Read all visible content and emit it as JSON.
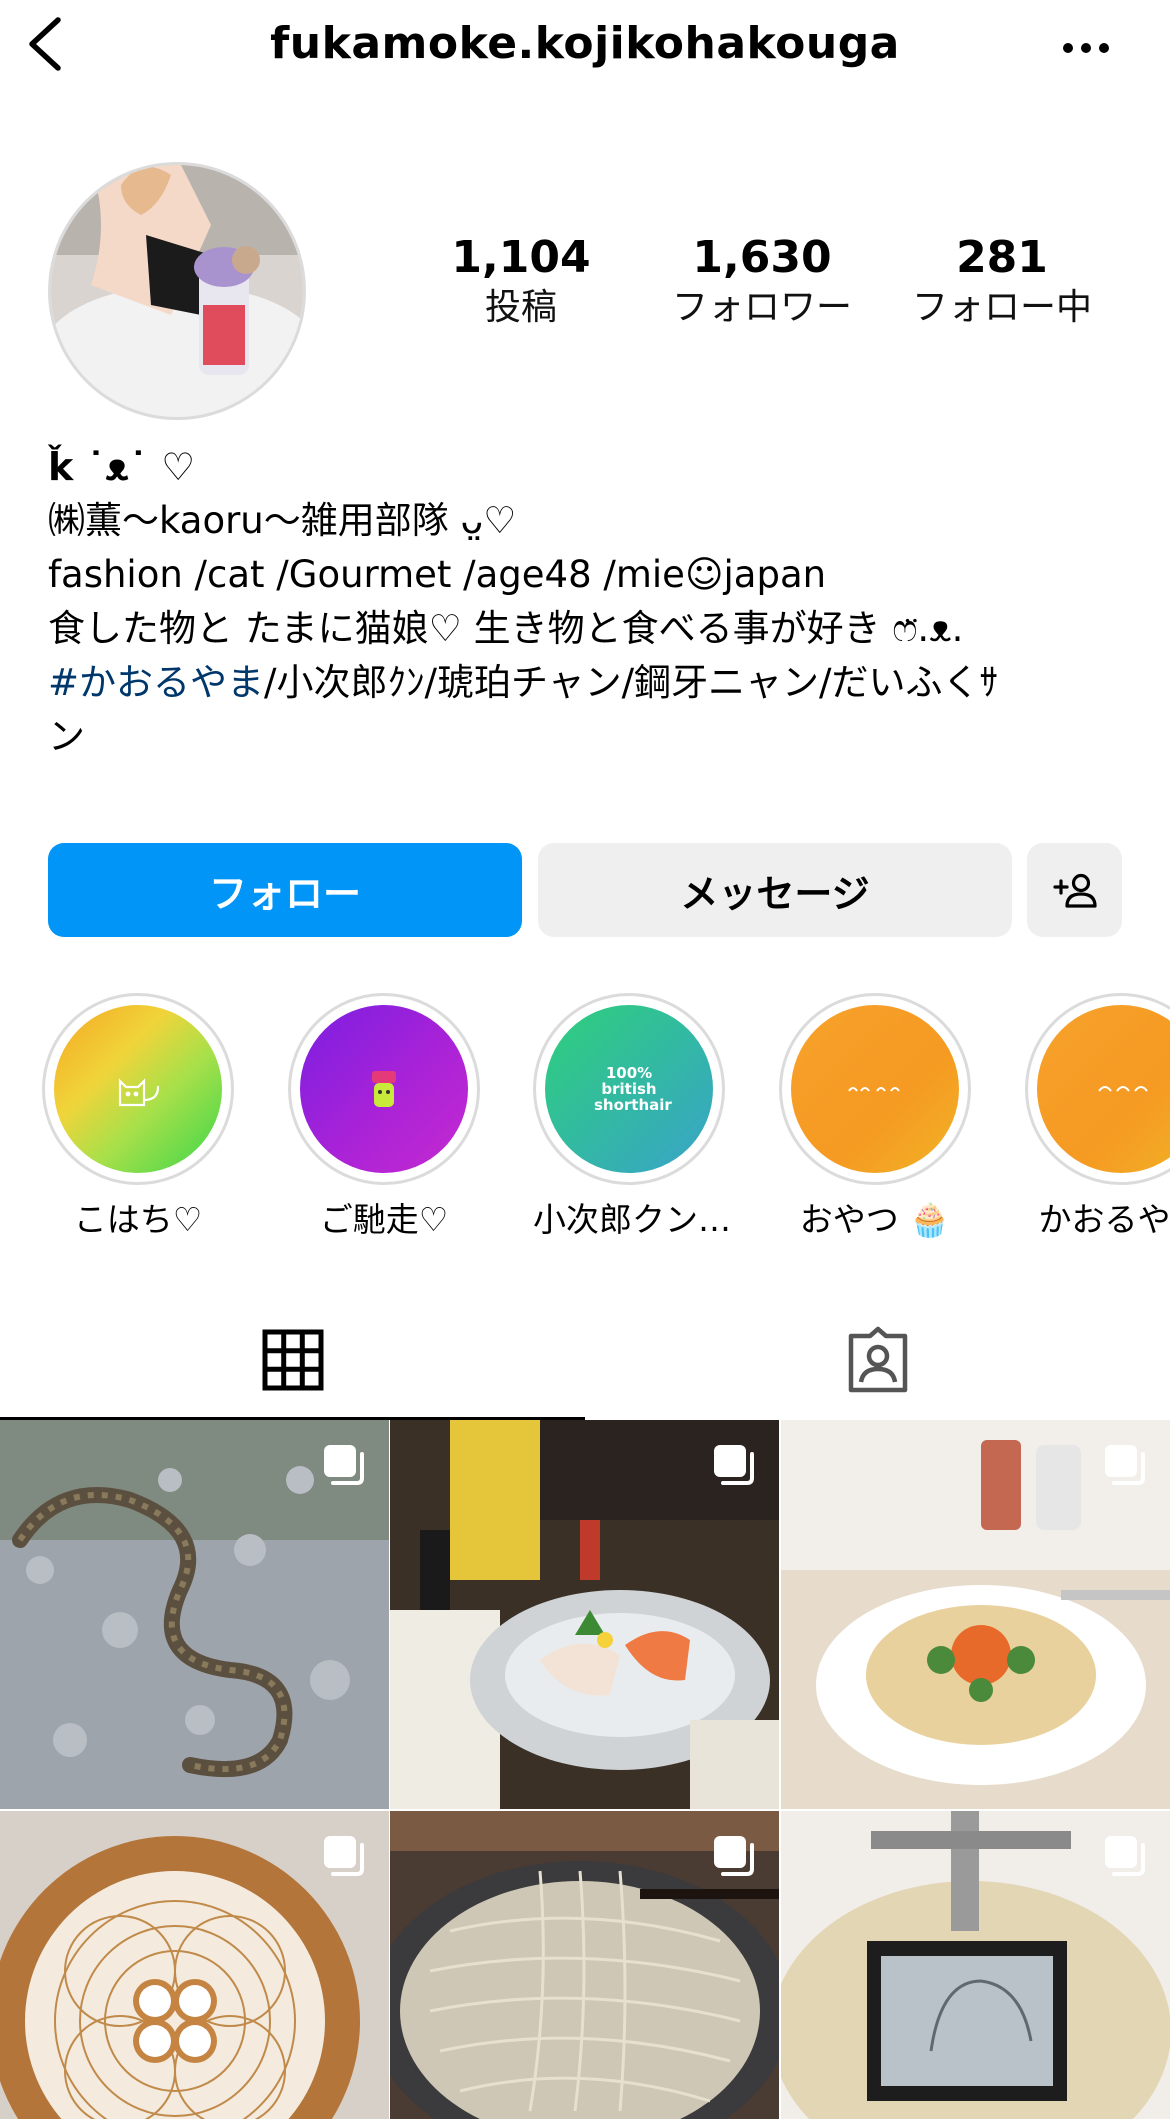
{
  "header": {
    "username": "fukamoke.kojikohakouga"
  },
  "stats": [
    {
      "value": "1,104",
      "label": "投稿"
    },
    {
      "value": "1,630",
      "label": "フォロワー"
    },
    {
      "value": "281",
      "label": "フォロー中"
    }
  ],
  "bio": {
    "name": "ǩ ˙ᴥ˙ ♡",
    "line1": "㈱薫〜kaoru〜雑用部隊 ᴗ̤♡",
    "line2": "fashion /cat /Gourmet /age48 /mie☺japan",
    "line3": "食した物と たまに猫娘♡ 生き物と食べる事が好き ෆ̈.ᴥ.",
    "hashtag": "#かおるやま",
    "line4_rest": "/小次郎ｸﾝ/琥珀チャン/鋼牙ニャン/だいふくｻ",
    "line5": "ン"
  },
  "buttons": {
    "follow": "フォロー",
    "message": "メッセージ"
  },
  "highlights": [
    {
      "label": "こはち♡",
      "inner_text": ""
    },
    {
      "label": "ご馳走♡",
      "inner_text": ""
    },
    {
      "label": "小次郎クン…",
      "inner_text": "100% british shorthair"
    },
    {
      "label": "おやつ 🧁",
      "inner_text": ""
    },
    {
      "label": "かおるやま",
      "inner_text": ""
    }
  ],
  "icons": {
    "back": "chevron-left-icon",
    "more": "more-icon",
    "add_user": "add-user-icon",
    "grid": "grid-icon",
    "tagged": "tagged-icon",
    "multiple": "multiple-posts-icon"
  },
  "colors": {
    "follow_button": "#0095f6",
    "secondary_button": "#efefef",
    "hashtag": "#00376b"
  }
}
